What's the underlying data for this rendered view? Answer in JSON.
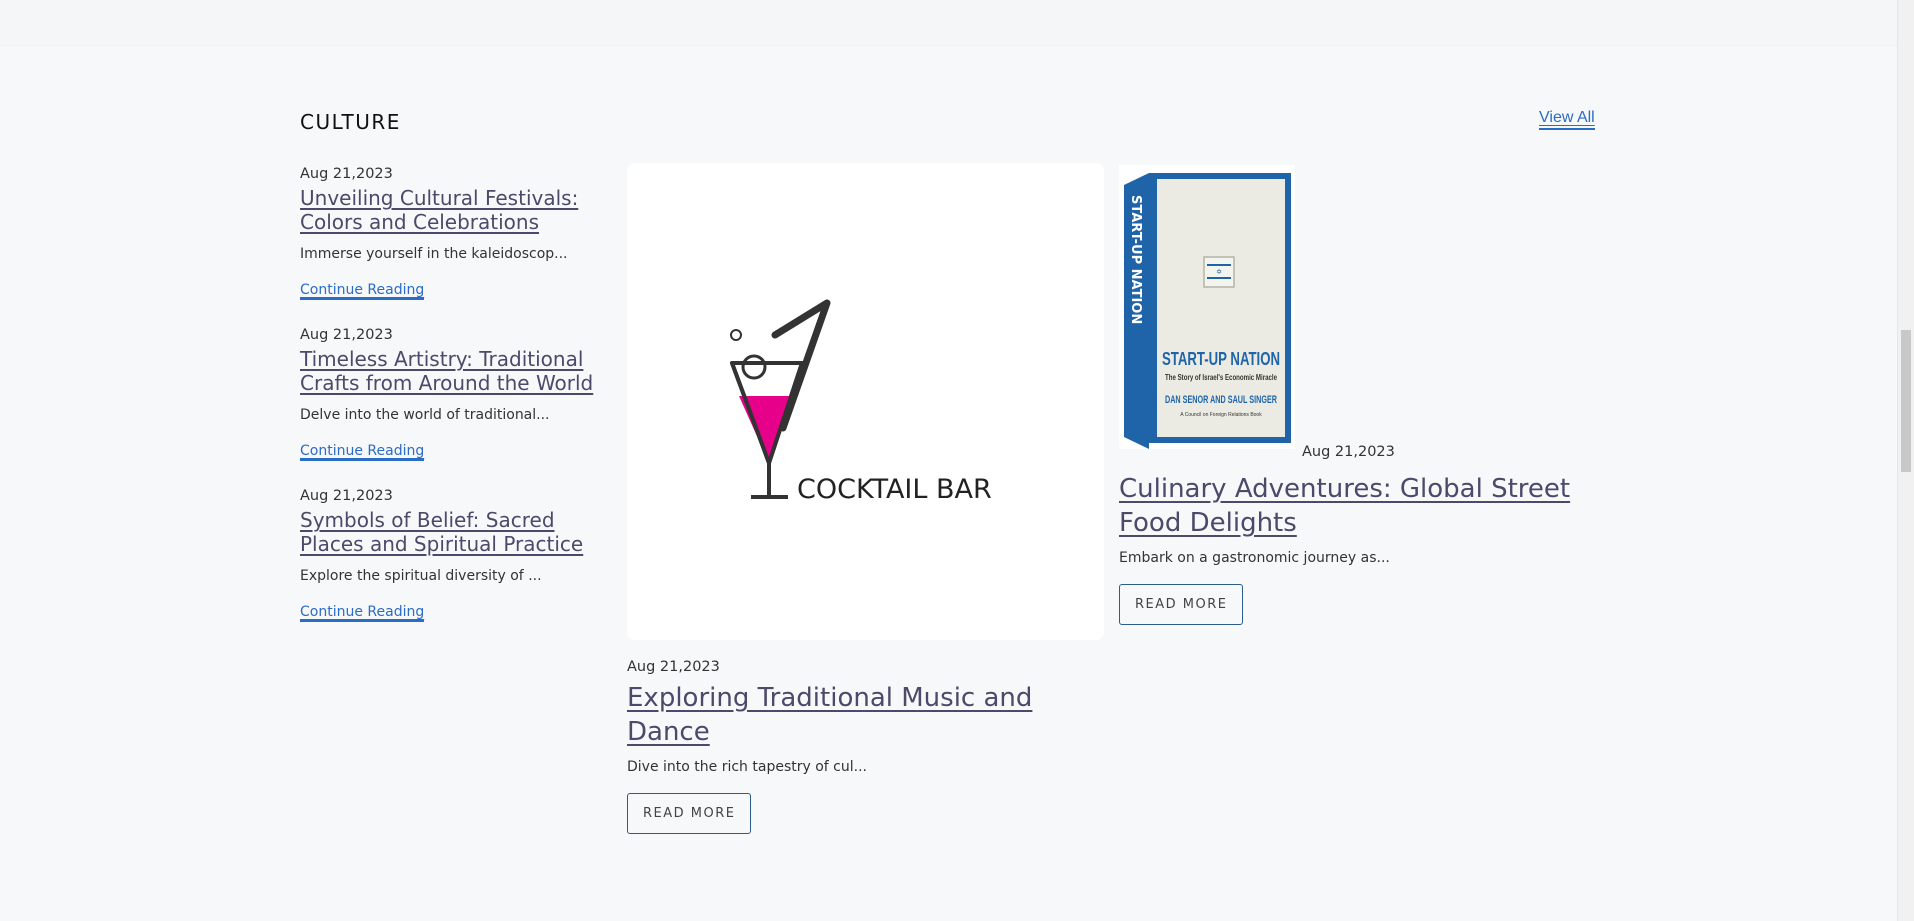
{
  "section": {
    "title": "CULTURE",
    "view_all": "View All"
  },
  "side_posts": [
    {
      "date": "Aug 21,2023",
      "title": "Unveiling Cultural Festivals: Colors and Celebrations",
      "excerpt": "Immerse yourself in the kaleidoscop...",
      "link": "Continue Reading"
    },
    {
      "date": "Aug 21,2023",
      "title": "Timeless Artistry: Traditional Crafts from Around the World",
      "excerpt": "Delve into the world of traditional...",
      "link": "Continue Reading"
    },
    {
      "date": "Aug 21,2023",
      "title": "Symbols of Belief: Sacred Places and Spiritual Practice",
      "excerpt": "Explore the spiritual diversity of ...",
      "link": "Continue Reading"
    }
  ],
  "featured": {
    "image_text": "COCKTAIL BAR",
    "date": "Aug 21,2023",
    "title": "Exploring Traditional Music and Dance",
    "excerpt": "Dive into the rich tapestry of cul...",
    "button": "READ MORE"
  },
  "secondary": {
    "book_title": "START-UP NATION",
    "book_subtitle": "The Story of Israel's Economic Miracle",
    "book_authors": "DAN SENOR AND SAUL SINGER",
    "book_note": "A Council on Foreign Relations Book",
    "book_spine": "START-UP NATION",
    "date": "Aug 21,2023",
    "title": "Culinary Adventures: Global Street Food Delights",
    "excerpt": "Embark on a gastronomic journey as...",
    "button": "READ MORE"
  },
  "colors": {
    "link": "#2b6cc4",
    "title": "#4a4a6a",
    "accent_pink": "#e6008a",
    "book_blue": "#1f64a8"
  }
}
